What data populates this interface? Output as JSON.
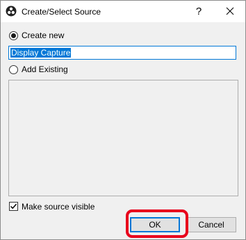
{
  "window": {
    "title": "Create/Select Source",
    "help_label": "?",
    "app_icon": "obs-logo-icon",
    "close_icon": "close-icon"
  },
  "form": {
    "create_new_label": "Create new",
    "create_new_selected": true,
    "source_name_value": "Display Capture",
    "add_existing_label": "Add Existing",
    "add_existing_selected": false,
    "existing_sources": [],
    "make_visible_label": "Make source visible",
    "make_visible_checked": true
  },
  "buttons": {
    "ok_label": "OK",
    "cancel_label": "Cancel"
  },
  "colors": {
    "selection": "#0078d7",
    "highlight": "#e8001c"
  }
}
